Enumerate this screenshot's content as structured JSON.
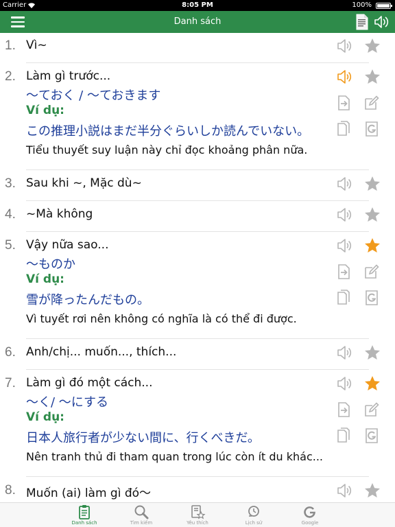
{
  "status": {
    "carrier": "Carrier",
    "time": "8:05 PM",
    "battery": "100%",
    "battery_level": 1.0
  },
  "nav": {
    "title": "Danh sách"
  },
  "colors": {
    "green": "#2e8b4a",
    "orange": "#f19a1c",
    "blue": "#1f3f9a",
    "gray_icon": "#b5b5b5"
  },
  "items": [
    {
      "num": "1.",
      "meaning": "Vì~",
      "starred": false,
      "speaking": false,
      "expanded": false
    },
    {
      "num": "2.",
      "meaning": "Làm gì trước...",
      "pattern": "〜ておく / 〜ておきます",
      "label": "Ví dụ:",
      "example": "この推理小説はまだ半分ぐらいしか読んでいない。",
      "translation": "Tiểu thuyết suy luận này chỉ đọc khoảng phân nữa.",
      "starred": false,
      "speaking": true,
      "expanded": true
    },
    {
      "num": "3.",
      "meaning": "Sau khi ~, Mặc dù~",
      "starred": false,
      "speaking": false,
      "expanded": false
    },
    {
      "num": "4.",
      "meaning": "~Mà không",
      "starred": false,
      "speaking": false,
      "expanded": false
    },
    {
      "num": "5.",
      "meaning": "Vậy nữa sao...",
      "pattern": "〜ものか",
      "label": "Ví dụ:",
      "example": "雪が降ったんだもの。",
      "translation": "Vì tuyết rơi nên không có nghĩa là có thể đi được.",
      "starred": true,
      "speaking": false,
      "expanded": true
    },
    {
      "num": "6.",
      "meaning": "Anh/chị... muốn..., thích...",
      "starred": false,
      "speaking": false,
      "expanded": false
    },
    {
      "num": "7.",
      "meaning": "Làm gì đó một cách...",
      "pattern": "〜く/ 〜にする",
      "label": "Ví dụ:",
      "example": "日本人旅行者が少ない間に、行くべきだ。",
      "translation": "Nên tranh thủ đi tham quan trong lúc còn ít du khác...",
      "starred": true,
      "speaking": false,
      "expanded": true
    },
    {
      "num": "8.",
      "meaning": "Muốn (ai) làm gì đó〜",
      "starred": false,
      "speaking": false,
      "expanded": false
    }
  ],
  "tabs": [
    {
      "label": "Danh sách",
      "icon": "clipboard-icon",
      "active": true
    },
    {
      "label": "Tìm kiếm",
      "icon": "search-icon",
      "active": false
    },
    {
      "label": "Yêu thích",
      "icon": "favorite-icon",
      "active": false
    },
    {
      "label": "Lịch sử",
      "icon": "history-icon",
      "active": false
    },
    {
      "label": "Google",
      "icon": "google-icon",
      "active": false
    }
  ]
}
